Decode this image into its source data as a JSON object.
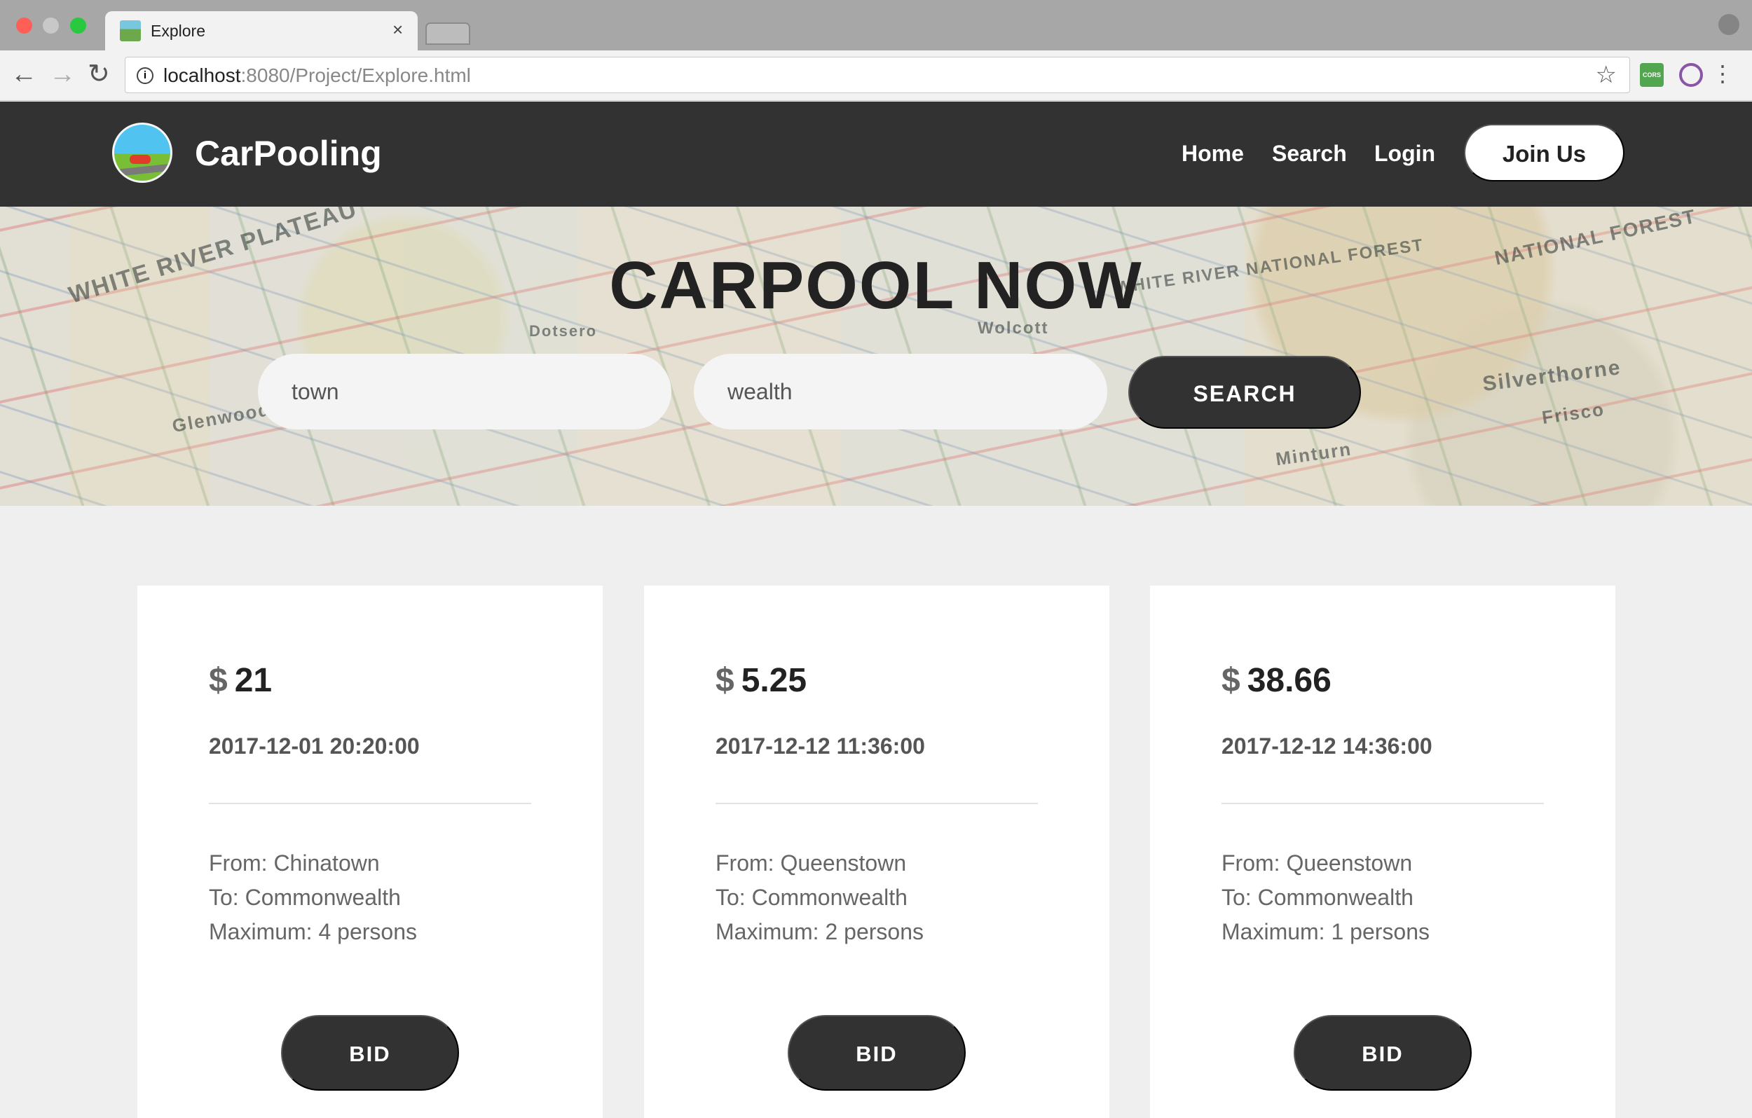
{
  "browser": {
    "tab_title": "Explore",
    "close_glyph": "×",
    "url_host": "localhost",
    "url_path": ":8080/Project/Explore.html",
    "extension_cors_label": "CORS"
  },
  "site": {
    "brand": "CarPooling",
    "nav": [
      "Home",
      "Search",
      "Login"
    ],
    "join_label": "Join Us"
  },
  "hero": {
    "title": "CARPOOL NOW",
    "from_value": "town",
    "to_value": "wealth",
    "search_label": "SEARCH",
    "map_labels": [
      "WHITE RIVER PLATEAU",
      "Dotsero",
      "Wolcott",
      "WHITE RIVER NATIONAL FOREST",
      "NATIONAL FOREST",
      "Silverthorne",
      "Frisco",
      "Minturn",
      "Glenwood"
    ]
  },
  "rides": [
    {
      "currency": "$",
      "price": "21",
      "date": "2017-12-01 20:20:00",
      "from": "From: Chinatown",
      "to": "To: Commonwealth",
      "maximum": "Maximum: 4 persons",
      "bid_label": "BID"
    },
    {
      "currency": "$",
      "price": "5.25",
      "date": "2017-12-12 11:36:00",
      "from": "From: Queenstown",
      "to": "To: Commonwealth",
      "maximum": "Maximum: 2 persons",
      "bid_label": "BID"
    },
    {
      "currency": "$",
      "price": "38.66",
      "date": "2017-12-12 14:36:00",
      "from": "From: Queenstown",
      "to": "To: Commonwealth",
      "maximum": "Maximum: 1 persons",
      "bid_label": "BID"
    }
  ],
  "icons": [
    "back-arrow-icon",
    "forward-arrow-icon",
    "reload-icon",
    "info-icon",
    "star-icon",
    "menu-dots-icon",
    "profile-icon"
  ]
}
